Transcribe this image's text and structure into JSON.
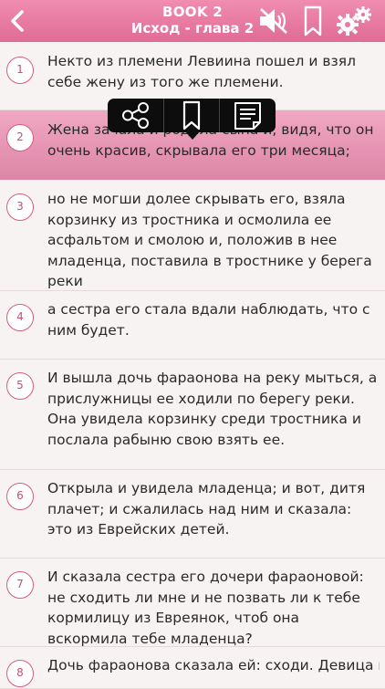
{
  "header": {
    "book": "BOOK 2",
    "chapter": "Исход - глава 2",
    "icons": [
      "back-chevron-icon",
      "speaker-muted-icon",
      "bookmark-icon",
      "settings-gears-icon"
    ]
  },
  "popup_menu": {
    "icons": [
      "share-icon",
      "bookmark-icon",
      "note-icon"
    ]
  },
  "selected_verse": "2",
  "verses": [
    {
      "num": "1",
      "text": "Некто из племени Левиина пошел и взял себе жену из того же племени."
    },
    {
      "num": "2",
      "text": "Жена зачала и родила сына и, видя, что он очень красив, скрывала его три месяца;"
    },
    {
      "num": "3",
      "text": "но не могши долее скрывать его, взяла корзинку из тростника и осмолила ее асфальтом и смолою и, положив в нее младенца, поставила в тростнике у берега реки"
    },
    {
      "num": "4",
      "text": "а сестра его стала вдали наблюдать, что с ним будет."
    },
    {
      "num": "5",
      "text": "И вышла дочь фараонова на реку мыться, а прислужницы ее ходили по берегу реки. Она увидела корзинку среди тростника и послала рабыню свою взять ее."
    },
    {
      "num": "6",
      "text": "Открыла и увидела младенца; и вот, дитя плачет; и сжалилась над ним и сказала: это из Еврейских детей."
    },
    {
      "num": "7",
      "text": "И сказала сестра его дочери фараоновой: не сходить ли мне и не позвать ли к тебе кормилицу из Евреянок, чтоб она вскормила тебе младенца?"
    },
    {
      "num": "8",
      "text": "Дочь фараонова сказала ей: сходи. Девица пошла и"
    }
  ],
  "colors": {
    "header": "#e87aa3",
    "selected_row": "#e996b5",
    "number_ring": "#d75b7e"
  }
}
